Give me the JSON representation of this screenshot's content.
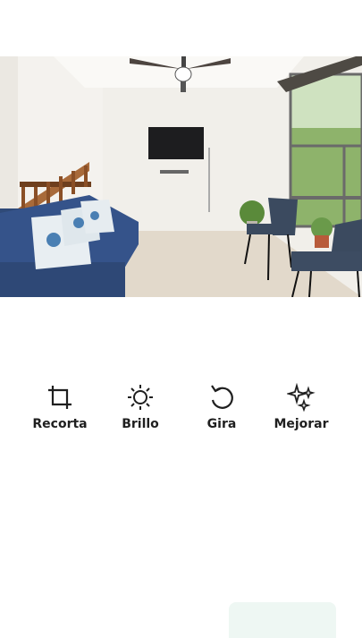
{
  "tools": [
    {
      "label": "Recorta",
      "icon": "crop-icon"
    },
    {
      "label": "Brillo",
      "icon": "brightness-icon"
    },
    {
      "label": "Gira",
      "icon": "rotate-icon"
    },
    {
      "label": "Mejorar",
      "icon": "sparkles-icon"
    }
  ],
  "colors": {
    "text": "#1f1f1f",
    "background": "#ffffff",
    "bottom_button": "#eef7f3"
  }
}
